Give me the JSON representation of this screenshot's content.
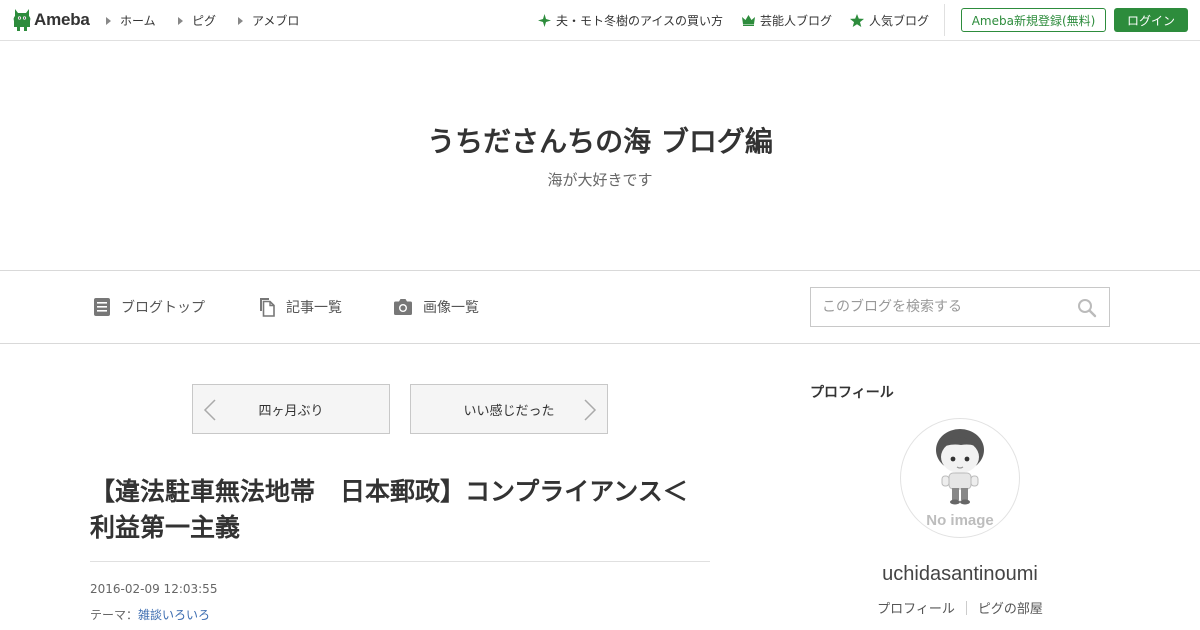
{
  "header": {
    "logo_text": "Ameba",
    "nav": [
      {
        "label": "ホーム"
      },
      {
        "label": "ピグ"
      },
      {
        "label": "アメブロ"
      }
    ],
    "right_links": [
      {
        "label": "夫・モト冬樹のアイスの買い方",
        "icon": "sparkle-icon"
      },
      {
        "label": "芸能人ブログ",
        "icon": "crown-icon"
      },
      {
        "label": "人気ブログ",
        "icon": "star-icon"
      }
    ],
    "register_label": "Ameba新規登録(無料)",
    "login_label": "ログイン"
  },
  "blog": {
    "title": "うちださんちの海 ブログ編",
    "description": "海が大好きです"
  },
  "subnav": {
    "items": [
      {
        "label": "ブログトップ",
        "icon": "document-icon"
      },
      {
        "label": "記事一覧",
        "icon": "copy-icon"
      },
      {
        "label": "画像一覧",
        "icon": "camera-icon"
      }
    ],
    "search_placeholder": "このブログを検索する"
  },
  "pager": {
    "prev_label": "四ヶ月ぶり",
    "next_label": "いい感じだった"
  },
  "article": {
    "title": "【違法駐車無法地帯　日本郵政】コンプライアンス＜利益第一主義",
    "date": "2016-02-09 12:03:55",
    "theme_prefix": "テーマ：",
    "theme": "雑談いろいろ"
  },
  "sidebar": {
    "heading": "プロフィール",
    "avatar_text": "No image",
    "username": "uchidasantinoumi",
    "links": [
      {
        "label": "プロフィール"
      },
      {
        "label": "ピグの部屋"
      }
    ]
  },
  "colors": {
    "brand_green": "#2d8c3c",
    "link_blue": "#3b6cb0"
  }
}
